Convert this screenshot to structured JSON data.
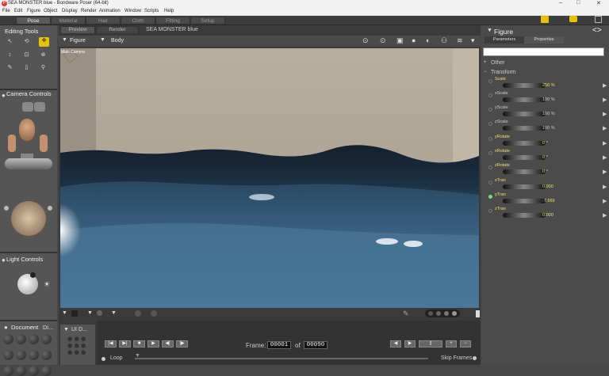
{
  "titlebar": {
    "title": "SEA MONSTER blue - Bondware Poser (64-bit)",
    "minimize": "–",
    "maximize": "□",
    "close": "✕"
  },
  "menubar": {
    "items": [
      "File",
      "Edit",
      "Figure",
      "Object",
      "Display",
      "Render",
      "Animation",
      "Window",
      "Scripts",
      "Help"
    ]
  },
  "rooms": {
    "items": [
      "Pose",
      "Material",
      "Hair",
      "Cloth",
      "Fitting",
      "Setup"
    ]
  },
  "center_tabs": {
    "preview": "Preview",
    "render": "Render",
    "doc_title": "SEA MONSTER blue"
  },
  "viewport": {
    "figure_menu": "Figure",
    "body_menu": "Body",
    "camera_label": "Main Camera"
  },
  "left_panels": {
    "editing_tools": "Editing Tools",
    "camera_controls": "Camera Controls",
    "light_controls": "Light Controls",
    "document": "Document",
    "document_tab2": "Di...",
    "ui_dots": "UI D..."
  },
  "right_panel": {
    "title": "Figure",
    "tab_parameters": "Parameters",
    "tab_properties": "Properties",
    "group_other": "Other",
    "group_transform": "Transform",
    "params": [
      {
        "name": "Scale",
        "value": "250 %",
        "highlight": true
      },
      {
        "name": "xScale",
        "value": "100 %",
        "highlight": false
      },
      {
        "name": "yScale",
        "value": "100 %",
        "highlight": false
      },
      {
        "name": "zScale",
        "value": "100 %",
        "highlight": false
      },
      {
        "name": "yRotate",
        "value": "0 °",
        "highlight": true
      },
      {
        "name": "xRotate",
        "value": "0 °",
        "highlight": true
      },
      {
        "name": "zRotate",
        "value": "0 °",
        "highlight": true
      },
      {
        "name": "xTran",
        "value": "0.000",
        "highlight": true
      },
      {
        "name": "yTran",
        "value": "-7.669",
        "highlight": true
      },
      {
        "name": "zTran",
        "value": "0.000",
        "highlight": true
      }
    ]
  },
  "animation": {
    "frame_label": "Frame:",
    "frame_value": "00001",
    "of_label": "of",
    "total_frames": "00090",
    "loop_label": "Loop",
    "skip_frames_label": "Skip Frames"
  },
  "colors": {
    "accent_yellow": "#e8c200",
    "param_highlight": "#e8e070",
    "sea_dark": "#1e3346",
    "sea_light": "#4b7698",
    "backdrop": "#b5ab9e"
  }
}
